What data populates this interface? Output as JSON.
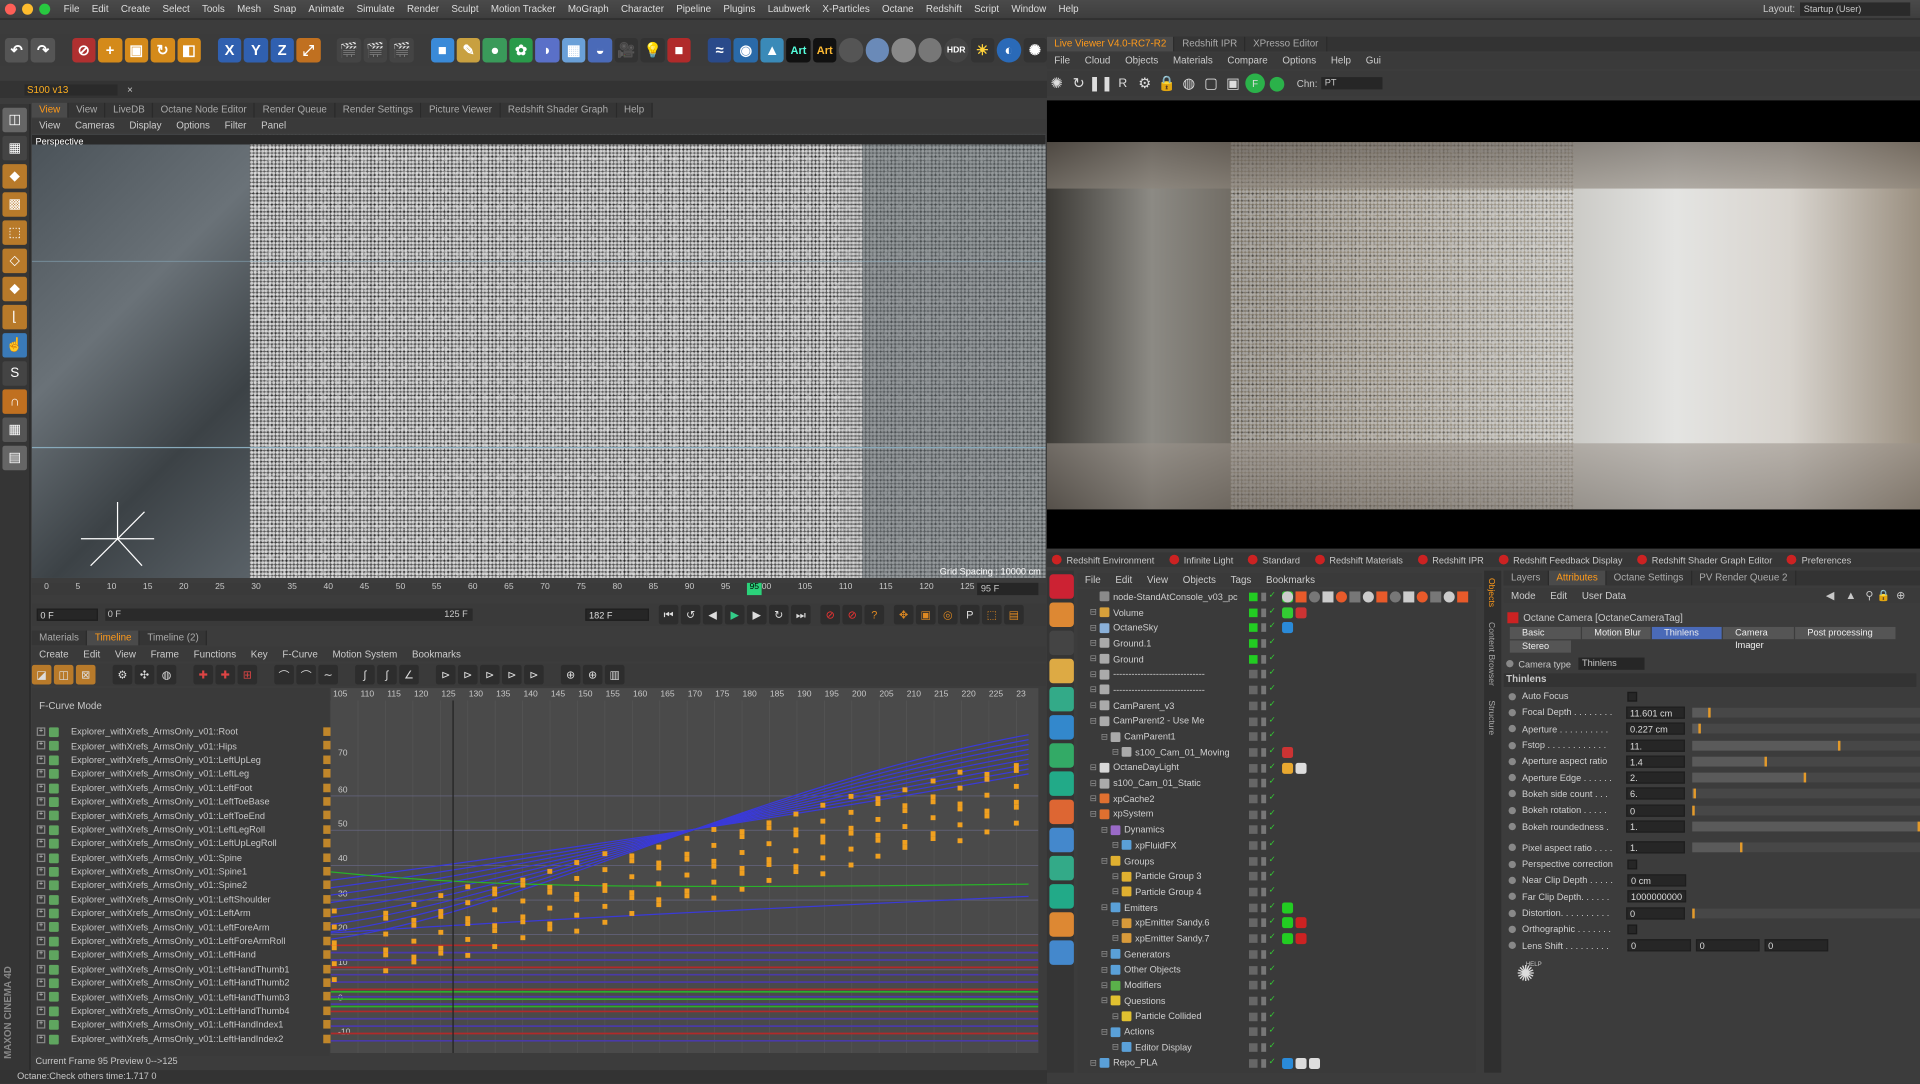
{
  "app": {
    "layout_label": "Layout:",
    "layout_value": "Startup (User)",
    "project_tab": "S100 v13",
    "status": "Octane:Check others time:1.717  0",
    "current_frame_text": "Current Frame  95  Preview  0-->125",
    "brand": "MAXON CINEMA 4D"
  },
  "menu": [
    "File",
    "Edit",
    "Create",
    "Select",
    "Tools",
    "Mesh",
    "Snap",
    "Animate",
    "Simulate",
    "Render",
    "Sculpt",
    "Motion Tracker",
    "MoGraph",
    "Character",
    "Pipeline",
    "Plugins",
    "Laubwerk",
    "X-Particles",
    "Octane",
    "Redshift",
    "Script",
    "Window",
    "Help"
  ],
  "toolbar_art": [
    "Art",
    "Art"
  ],
  "view_tabs": [
    "View",
    "View",
    "LiveDB",
    "Octane Node Editor",
    "Render Queue",
    "Render Settings",
    "Picture Viewer",
    "Redshift Shader Graph",
    "Help"
  ],
  "viewport": {
    "menu": [
      "View",
      "Cameras",
      "Display",
      "Options",
      "Filter",
      "Panel"
    ],
    "label": "Perspective",
    "grid": "Grid Spacing : 10000 cm"
  },
  "timeline_ruler": [
    "0",
    "5",
    "10",
    "15",
    "20",
    "25",
    "30",
    "35",
    "40",
    "45",
    "50",
    "55",
    "60",
    "65",
    "70",
    "75",
    "80",
    "85",
    "90",
    "95",
    "100",
    "105",
    "110",
    "115",
    "120",
    "125"
  ],
  "time_fields": {
    "start": "0 F",
    "range_a": "0 F",
    "range_b": "125 F",
    "end": "182 F",
    "cur": "95 F",
    "playhead": "95"
  },
  "bottom_tabs": [
    "Materials",
    "Timeline",
    "Timeline (2)"
  ],
  "timeline_menu": [
    "Create",
    "Edit",
    "View",
    "Frame",
    "Functions",
    "Key",
    "F-Curve",
    "Motion System",
    "Bookmarks"
  ],
  "fcurve": {
    "mode": "F-Curve Mode",
    "frame_ticks": [
      "105",
      "110",
      "115",
      "120",
      "125",
      "130",
      "135",
      "140",
      "145",
      "150",
      "155",
      "160",
      "165",
      "170",
      "175",
      "180",
      "185",
      "190",
      "195",
      "200",
      "205",
      "210",
      "215",
      "220",
      "225",
      "23"
    ],
    "y_ticks": [
      "70",
      "60",
      "50",
      "40",
      "30",
      "20",
      "10",
      "0",
      "-10"
    ],
    "tracks": [
      "Explorer_withXrefs_ArmsOnly_v01::Root",
      "Explorer_withXrefs_ArmsOnly_v01::Hips",
      "Explorer_withXrefs_ArmsOnly_v01::LeftUpLeg",
      "Explorer_withXrefs_ArmsOnly_v01::LeftLeg",
      "Explorer_withXrefs_ArmsOnly_v01::LeftFoot",
      "Explorer_withXrefs_ArmsOnly_v01::LeftToeBase",
      "Explorer_withXrefs_ArmsOnly_v01::LeftToeEnd",
      "Explorer_withXrefs_ArmsOnly_v01::LeftLegRoll",
      "Explorer_withXrefs_ArmsOnly_v01::LeftUpLegRoll",
      "Explorer_withXrefs_ArmsOnly_v01::Spine",
      "Explorer_withXrefs_ArmsOnly_v01::Spine1",
      "Explorer_withXrefs_ArmsOnly_v01::Spine2",
      "Explorer_withXrefs_ArmsOnly_v01::LeftShoulder",
      "Explorer_withXrefs_ArmsOnly_v01::LeftArm",
      "Explorer_withXrefs_ArmsOnly_v01::LeftForeArm",
      "Explorer_withXrefs_ArmsOnly_v01::LeftForeArmRoll",
      "Explorer_withXrefs_ArmsOnly_v01::LeftHand",
      "Explorer_withXrefs_ArmsOnly_v01::LeftHandThumb1",
      "Explorer_withXrefs_ArmsOnly_v01::LeftHandThumb2",
      "Explorer_withXrefs_ArmsOnly_v01::LeftHandThumb3",
      "Explorer_withXrefs_ArmsOnly_v01::LeftHandThumb4",
      "Explorer_withXrefs_ArmsOnly_v01::LeftHandIndex1",
      "Explorer_withXrefs_ArmsOnly_v01::LeftHandIndex2"
    ]
  },
  "live_viewer": {
    "tabs": [
      "Live Viewer V4.0-RC7-R2",
      "Redshift IPR",
      "XPresso Editor"
    ],
    "menu": [
      "File",
      "Cloud",
      "Objects",
      "Materials",
      "Compare",
      "Options",
      "Help",
      "Gui"
    ],
    "chn_label": "Chn:",
    "chn_value": "PT"
  },
  "rs_bar": [
    "Redshift Environment",
    "Infinite Light",
    "Standard",
    "Redshift Materials",
    "Redshift IPR",
    "Redshift Feedback Display",
    "Redshift Shader Graph Editor",
    "Preferences"
  ],
  "objects": {
    "menu": [
      "File",
      "Edit",
      "View",
      "Objects",
      "Tags",
      "Bookmarks"
    ],
    "items": [
      {
        "name": "node-StandAtConsole_v03_pc",
        "indent": 0,
        "color": "#8a8a8a"
      },
      {
        "name": "Volume",
        "indent": 0,
        "color": "#d7a03a"
      },
      {
        "name": "OctaneSky",
        "indent": 0,
        "color": "#8ab0d8"
      },
      {
        "name": "Ground.1",
        "indent": 0,
        "color": "#aaa"
      },
      {
        "name": "Ground",
        "indent": 0,
        "color": "#aaa"
      },
      {
        "name": "------------------------------",
        "indent": 0,
        "color": "#aaa"
      },
      {
        "name": "------------------------------",
        "indent": 0,
        "color": "#aaa"
      },
      {
        "name": "CamParent_v3",
        "indent": 0,
        "color": "#aaa"
      },
      {
        "name": "CamParent2 - Use Me",
        "indent": 0,
        "color": "#aaa"
      },
      {
        "name": "CamParent1",
        "indent": 1,
        "color": "#aaa"
      },
      {
        "name": "s100_Cam_01_Moving",
        "indent": 2,
        "color": "#aaa"
      },
      {
        "name": "OctaneDayLight",
        "indent": 0,
        "color": "#d8d8d8"
      },
      {
        "name": "s100_Cam_01_Static",
        "indent": 0,
        "color": "#aaa"
      },
      {
        "name": "xpCache2",
        "indent": 0,
        "color": "#e07030"
      },
      {
        "name": "xpSystem",
        "indent": 0,
        "color": "#e07030"
      },
      {
        "name": "Dynamics",
        "indent": 1,
        "color": "#9a6ac8"
      },
      {
        "name": "xpFluidFX",
        "indent": 2,
        "color": "#5aa0d8"
      },
      {
        "name": "Groups",
        "indent": 1,
        "color": "#e0b030"
      },
      {
        "name": "Particle Group 3",
        "indent": 2,
        "color": "#e0b030"
      },
      {
        "name": "Particle Group 4",
        "indent": 2,
        "color": "#e0b030"
      },
      {
        "name": "Emitters",
        "indent": 1,
        "color": "#5aa0d8"
      },
      {
        "name": "xpEmitter Sandy.6",
        "indent": 2,
        "color": "#d89a3a"
      },
      {
        "name": "xpEmitter Sandy.7",
        "indent": 2,
        "color": "#d89a3a"
      },
      {
        "name": "Generators",
        "indent": 1,
        "color": "#5aa0d8"
      },
      {
        "name": "Other Objects",
        "indent": 1,
        "color": "#5aa0d8"
      },
      {
        "name": "Modifiers",
        "indent": 1,
        "color": "#5ab04a"
      },
      {
        "name": "Questions",
        "indent": 1,
        "color": "#e0c030"
      },
      {
        "name": "Particle Collided",
        "indent": 2,
        "color": "#e0c030"
      },
      {
        "name": "Actions",
        "indent": 1,
        "color": "#5aa0d8"
      },
      {
        "name": "Editor Display",
        "indent": 2,
        "color": "#5aa0d8"
      },
      {
        "name": "Repo_PLA",
        "indent": 0,
        "color": "#5aa0d8"
      }
    ]
  },
  "side_tabs": [
    "Objects",
    "Content Browser",
    "Structure"
  ],
  "attributes": {
    "tabs": [
      "Layers",
      "Attributes",
      "Octane Settings",
      "PV Render Queue 2"
    ],
    "menu": [
      "Mode",
      "Edit",
      "User Data"
    ],
    "title": "Octane Camera [OctaneCameraTag]",
    "subtabs": [
      "Basic",
      "Motion Blur",
      "Thinlens",
      "Camera Imager",
      "Post processing",
      "Stereo"
    ],
    "camera_type_label": "Camera type",
    "camera_type_value": "Thinlens",
    "section": "Thinlens",
    "rows": [
      {
        "label": "Auto Focus",
        "type": "check",
        "value": ""
      },
      {
        "label": "Focal Depth . . . . . . . .",
        "type": "num",
        "value": "11.601 cm",
        "fill": 0.08
      },
      {
        "label": "Aperture . . . . . . . . . .",
        "type": "num",
        "value": "0.227 cm",
        "fill": 0.04
      },
      {
        "label": "Fstop . . . . . . . . . . . .",
        "type": "num",
        "value": "11.",
        "fill": 0.65
      },
      {
        "label": "Aperture aspect ratio",
        "type": "num",
        "value": "1.4",
        "fill": 0.33
      },
      {
        "label": "Aperture Edge . . . . . .",
        "type": "num",
        "value": "2.",
        "fill": 0.5
      },
      {
        "label": "Bokeh side count . . .",
        "type": "num",
        "value": "6.",
        "fill": 0.02
      },
      {
        "label": "Bokeh rotation . . . . .",
        "type": "num",
        "value": "0",
        "fill": 0.0
      },
      {
        "label": "Bokeh roundedness .",
        "type": "num",
        "value": "1.",
        "fill": 1.0
      },
      {
        "label": "gap",
        "type": "gap",
        "value": ""
      },
      {
        "label": "Pixel aspect ratio . . . .",
        "type": "num",
        "value": "1.",
        "fill": 0.22
      },
      {
        "label": "Perspective correction",
        "type": "check",
        "value": ""
      },
      {
        "label": "Near Clip Depth . . . . .",
        "type": "field",
        "value": "0 cm"
      },
      {
        "label": "Far Clip Depth. . . . . .",
        "type": "field",
        "value": "1000000000"
      },
      {
        "label": "Distortion. . . . . . . . . .",
        "type": "num",
        "value": "0",
        "fill": 0.0
      },
      {
        "label": "Orthographic . . . . . . .",
        "type": "check",
        "value": ""
      },
      {
        "label": "Lens Shift . . . . . . . . .",
        "type": "triple",
        "value": "0",
        "value2": "0",
        "value3": "0"
      }
    ],
    "help": "HELP"
  }
}
